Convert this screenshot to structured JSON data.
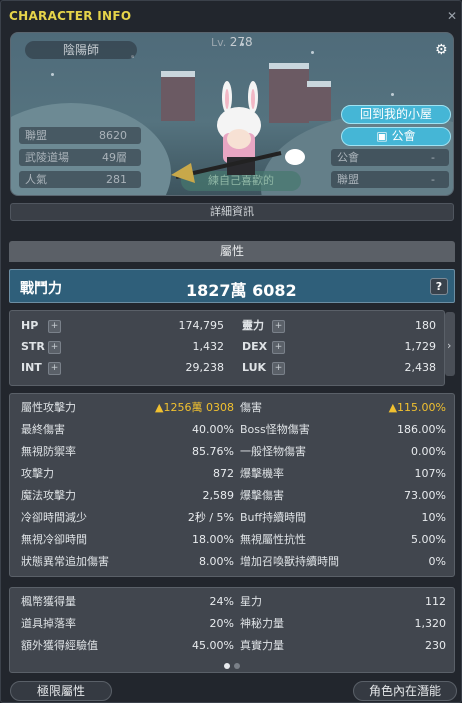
{
  "window": {
    "title": "CHARACTER INFO",
    "close_icon": "close-icon"
  },
  "profile": {
    "job": "陰陽師",
    "level_label": "Lv.",
    "level": "278",
    "left_stats": [
      {
        "label": "聯盟",
        "value": "8620"
      },
      {
        "label": "武陵道場",
        "value": "49層"
      },
      {
        "label": "人氣",
        "value": "281"
      }
    ],
    "right_stats": [
      {
        "label": "公會",
        "value": "-"
      },
      {
        "label": "聯盟",
        "value": "-"
      }
    ],
    "home_button": "回到我的小屋",
    "guild_button": "公會",
    "sign": "練自己喜歡的"
  },
  "detail_button": "詳細資訊",
  "section_title": "屬性",
  "power": {
    "label": "戰鬥力",
    "value": "1827萬 6082",
    "help": "?"
  },
  "base_stats": [
    {
      "l": "HP",
      "v": "174,795",
      "l2": "靈力",
      "v2": "180"
    },
    {
      "l": "STR",
      "v": "1,432",
      "l2": "DEX",
      "v2": "1,729"
    },
    {
      "l": "INT",
      "v": "29,238",
      "l2": "LUK",
      "v2": "2,438"
    }
  ],
  "combat_stats": [
    {
      "l": "屬性攻擊力",
      "v": "▲1256萬 0308",
      "gold": true,
      "l2": "傷害",
      "v2": "▲115.00%",
      "gold2": true
    },
    {
      "l": "最終傷害",
      "v": "40.00%",
      "l2": "Boss怪物傷害",
      "v2": "186.00%"
    },
    {
      "l": "無視防禦率",
      "v": "85.76%",
      "l2": "一般怪物傷害",
      "v2": "0.00%"
    },
    {
      "l": "攻擊力",
      "v": "872",
      "l2": "爆擊機率",
      "v2": "107%"
    },
    {
      "l": "魔法攻擊力",
      "v": "2,589",
      "l2": "爆擊傷害",
      "v2": "73.00%"
    },
    {
      "l": "冷卻時間減少",
      "v": "2秒 / 5%",
      "l2": "Buff持續時間",
      "v2": "10%"
    },
    {
      "l": "無視冷卻時間",
      "v": "18.00%",
      "l2": "無視屬性抗性",
      "v2": "5.00%"
    },
    {
      "l": "狀態異常追加傷害",
      "v": "8.00%",
      "l2": "增加召喚獸持續時間",
      "v2": "0%"
    }
  ],
  "misc_stats": [
    {
      "l": "楓幣獲得量",
      "v": "24%",
      "l2": "星力",
      "v2": "112"
    },
    {
      "l": "道具掉落率",
      "v": "20%",
      "l2": "神秘力量",
      "v2": "1,320"
    },
    {
      "l": "額外獲得經驗值",
      "v": "45.00%",
      "l2": "真實力量",
      "v2": "230"
    }
  ],
  "footer": {
    "left_button": "極限屬性",
    "right_button": "角色內在潛能"
  },
  "colors": {
    "accent": "#45b6d6",
    "gold": "#f0c030",
    "power_bg": "#2f5f7a"
  }
}
